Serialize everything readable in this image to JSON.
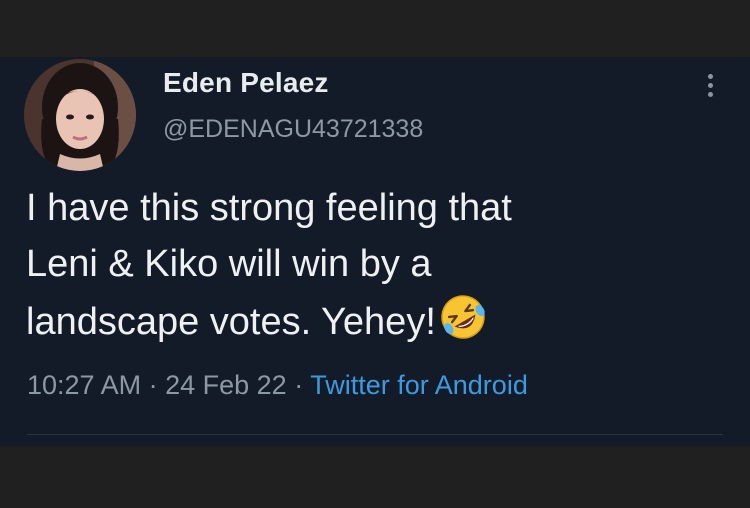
{
  "tweet": {
    "author": {
      "display_name": "Eden Pelaez",
      "handle": "@EDENAGU43721338",
      "avatar_icon": "profile-photo"
    },
    "text_lines": [
      "I have this strong feeling that",
      "Leni & Kiko will win by a",
      "landscape votes. Yehey!"
    ],
    "emoji": "rolling-on-the-floor-laughing-emoji",
    "time": "10:27 AM",
    "date": "24 Feb 22",
    "separator": "·",
    "source": "Twitter for Android",
    "menu_icon": "more-vertical-icon"
  },
  "colors": {
    "card_background": "#141b28",
    "frame_background": "#202020",
    "text_primary": "#eef0f2",
    "text_secondary": "#8c98a4",
    "link": "#3c9ae0"
  }
}
